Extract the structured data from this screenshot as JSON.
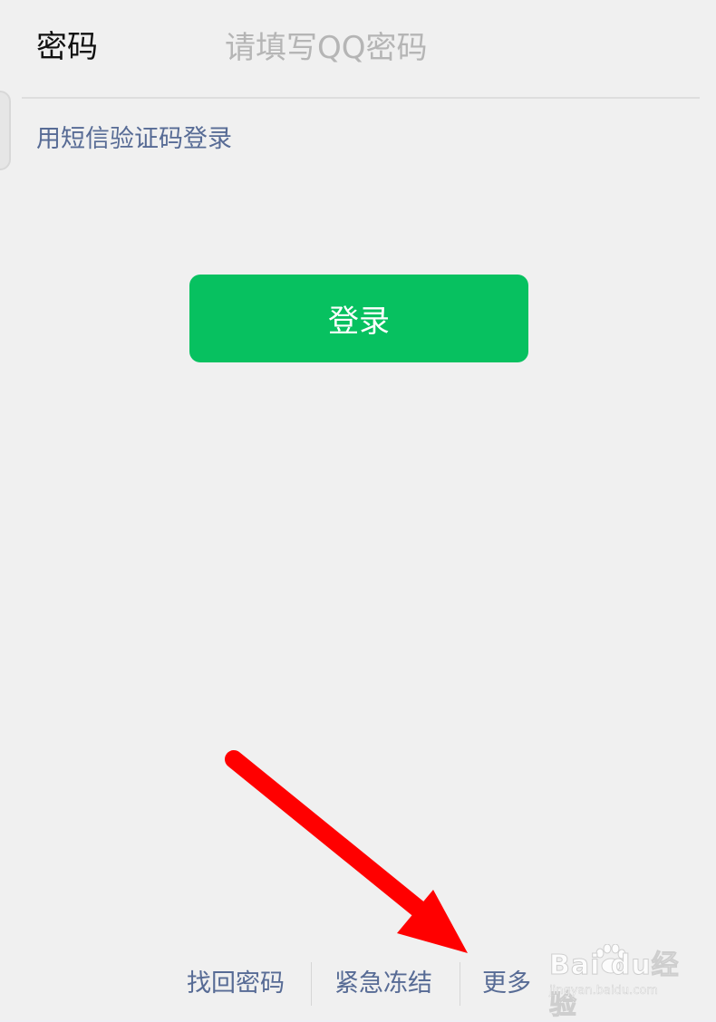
{
  "form": {
    "password_label": "密码",
    "password_placeholder": "请填写QQ密码",
    "sms_login_link": "用短信验证码登录",
    "login_button": "登录"
  },
  "footer_links": [
    "找回密码",
    "紧急冻结",
    "更多"
  ],
  "watermark": {
    "brand": "Bai du经验",
    "url": "jingyan.baidu.com"
  },
  "colors": {
    "accent_green": "#07c160",
    "link_blue": "#576b95",
    "annotation_arrow": "#ff0000"
  }
}
